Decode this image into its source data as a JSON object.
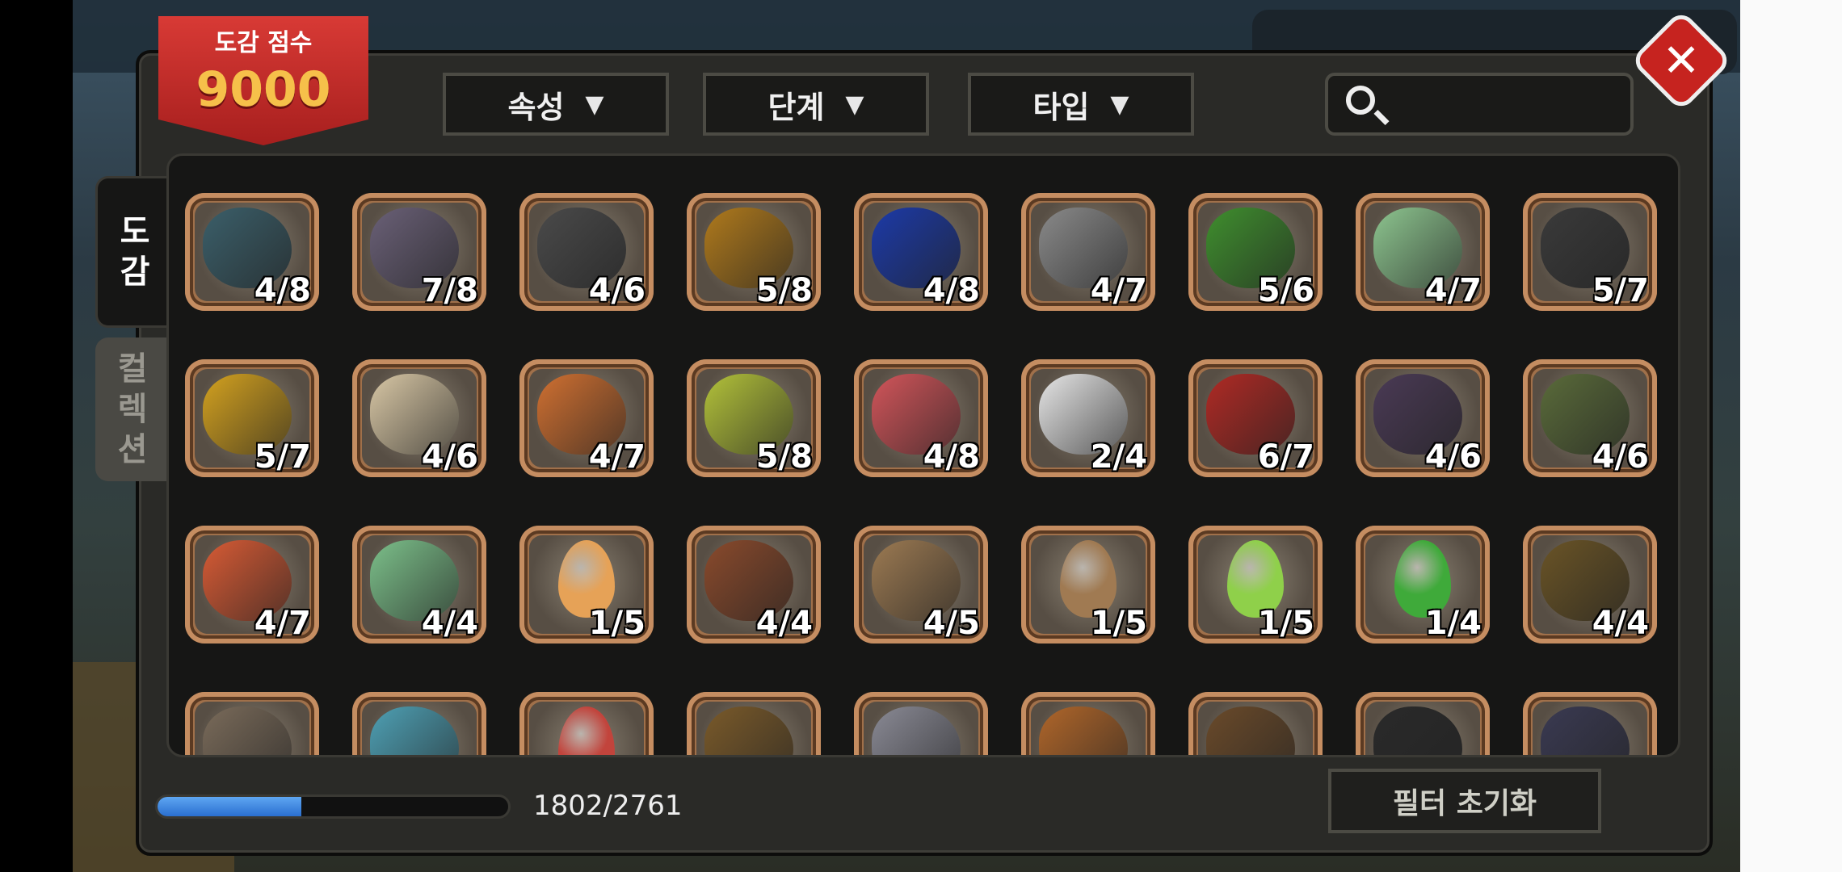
{
  "header": {
    "score_label": "도감 점수",
    "score_value": "9000",
    "filters": [
      "속성",
      "단계",
      "타입"
    ],
    "search_placeholder": ""
  },
  "side_tabs": [
    {
      "label": "도\n감",
      "active": true
    },
    {
      "label": "컬\n렉\n션",
      "active": false
    }
  ],
  "grid": {
    "rows": [
      [
        {
          "count": "4/8",
          "kind": "monster",
          "color": "#3b5f6a"
        },
        {
          "count": "7/8",
          "kind": "monster",
          "color": "#6a6077"
        },
        {
          "count": "4/6",
          "kind": "monster",
          "color": "#4a4a4a"
        },
        {
          "count": "5/8",
          "kind": "monster",
          "color": "#b07a1c"
        },
        {
          "count": "4/8",
          "kind": "monster",
          "color": "#1c3aa8"
        },
        {
          "count": "4/7",
          "kind": "monster",
          "color": "#8a8a8a"
        },
        {
          "count": "5/6",
          "kind": "monster",
          "color": "#3f8f2e"
        },
        {
          "count": "4/7",
          "kind": "monster",
          "color": "#8dc58f"
        },
        {
          "count": "5/7",
          "kind": "monster",
          "color": "#3a3a3a"
        }
      ],
      [
        {
          "count": "5/7",
          "kind": "monster",
          "color": "#d4a21f"
        },
        {
          "count": "4/6",
          "kind": "monster",
          "color": "#d8c7a5"
        },
        {
          "count": "4/7",
          "kind": "monster",
          "color": "#d07031"
        },
        {
          "count": "5/8",
          "kind": "monster",
          "color": "#b3c23a"
        },
        {
          "count": "4/8",
          "kind": "monster",
          "color": "#d2555a"
        },
        {
          "count": "2/4",
          "kind": "monster",
          "color": "#e6e6e6"
        },
        {
          "count": "6/7",
          "kind": "monster",
          "color": "#b02a24"
        },
        {
          "count": "4/6",
          "kind": "monster",
          "color": "#4a3a55"
        },
        {
          "count": "4/6",
          "kind": "monster",
          "color": "#5a6b3a"
        }
      ],
      [
        {
          "count": "4/7",
          "kind": "monster",
          "color": "#d85b35"
        },
        {
          "count": "4/4",
          "kind": "monster",
          "color": "#7cc08a"
        },
        {
          "count": "1/5",
          "kind": "egg",
          "color": "#e6a257"
        },
        {
          "count": "4/4",
          "kind": "monster",
          "color": "#8a4a2c"
        },
        {
          "count": "4/5",
          "kind": "monster",
          "color": "#9c7a52"
        },
        {
          "count": "1/5",
          "kind": "egg",
          "color": "#a07a52"
        },
        {
          "count": "1/5",
          "kind": "egg",
          "color": "#8fd04a"
        },
        {
          "count": "1/4",
          "kind": "egg",
          "color": "#3faa3a"
        },
        {
          "count": "4/4",
          "kind": "monster",
          "color": "#6a5426"
        }
      ],
      [
        {
          "count": "",
          "kind": "monster",
          "color": "#7a6b5a"
        },
        {
          "count": "",
          "kind": "monster",
          "color": "#4ea0b4"
        },
        {
          "count": "",
          "kind": "egg",
          "color": "#c2443c"
        },
        {
          "count": "",
          "kind": "monster",
          "color": "#7a5a2a"
        },
        {
          "count": "",
          "kind": "monster",
          "color": "#8a8a95"
        },
        {
          "count": "",
          "kind": "monster",
          "color": "#b0662a"
        },
        {
          "count": "",
          "kind": "monster",
          "color": "#6a4a2a"
        },
        {
          "count": "",
          "kind": "monster",
          "color": "#2a2a2a"
        },
        {
          "count": "",
          "kind": "monster",
          "color": "#3a3a52"
        }
      ]
    ]
  },
  "footer": {
    "progress_current": 1802,
    "progress_total": 2761,
    "progress_text": "1802/2761",
    "reset_label": "필터 초기화"
  },
  "colors": {
    "panel": "#2a2a27",
    "accent_red": "#c6231f",
    "progress_blue": "#3b86e0"
  }
}
